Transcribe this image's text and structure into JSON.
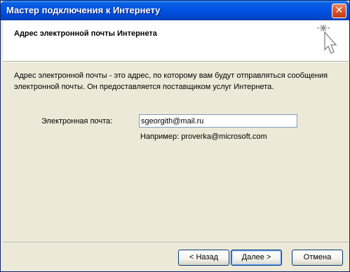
{
  "window": {
    "title": "Мастер подключения к Интернету"
  },
  "header": {
    "title": "Адрес электронной почты Интернета"
  },
  "body": {
    "description": "Адрес электронной почты - это адрес, по которому вам будут отправляться сообщения электронной почты. Он предоставляется поставщиком услуг Интернета.",
    "email_label": "Электронная почта:",
    "email_value": "sgeorgith@mail.ru",
    "example": "Например: proverka@microsoft.com"
  },
  "buttons": {
    "back": "< Назад",
    "next": "Далее >",
    "cancel": "Отмена"
  },
  "colors": {
    "titlebar": "#0054e3",
    "close": "#d9582e",
    "dialog_bg": "#ece9d8"
  },
  "icons": {
    "close": "close-icon",
    "wizard": "wizard-sparkle-cursor-icon"
  }
}
